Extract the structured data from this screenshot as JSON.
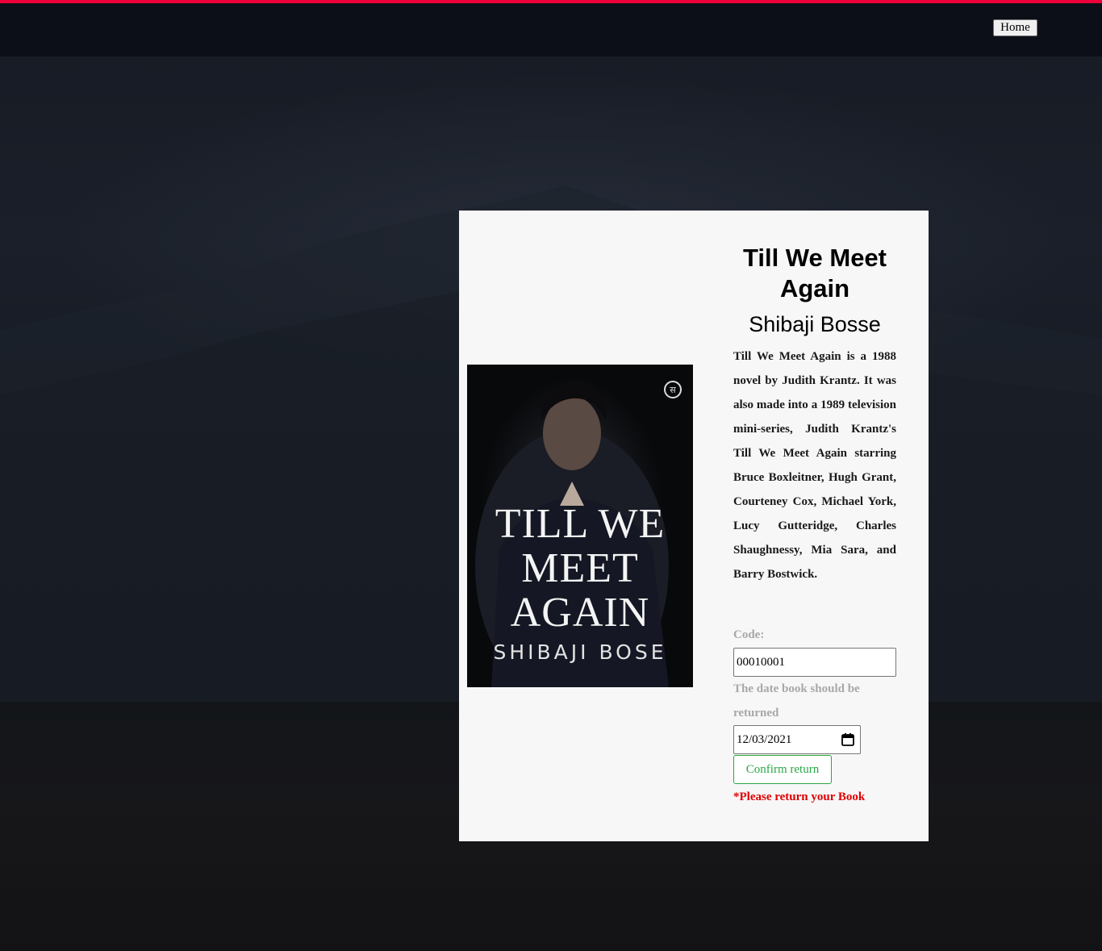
{
  "nav": {
    "home_label": "Home"
  },
  "book": {
    "title": "Till We Meet Again",
    "author": "Shibaji Bosse",
    "description": "Till We Meet Again is a 1988 novel by Judith Krantz. It was also made into a 1989 television mini-series, Judith Krantz's Till We Meet Again starring Bruce Boxleitner, Hugh Grant, Courteney Cox, Michael York, Lucy Gutteridge, Charles Shaughnessy, Mia Sara, and Barry Bostwick.",
    "cover": {
      "title_lines": [
        "TILL WE",
        "MEET",
        "AGAIN"
      ],
      "author": "SHIBAJI BOSE",
      "publisher_mark": "स"
    }
  },
  "form": {
    "code_label": "Code:",
    "code_value": "00010001",
    "date_label": "The date book should be returned",
    "date_value": "12/03/2021",
    "confirm_label": "Confirm return",
    "warning": "*Please return your Book"
  },
  "colors": {
    "accent_top_line": "#f0003a",
    "confirm_green": "#28a745",
    "warning_red": "#e00000"
  },
  "icons": {
    "date_picker": "calendar-icon"
  }
}
